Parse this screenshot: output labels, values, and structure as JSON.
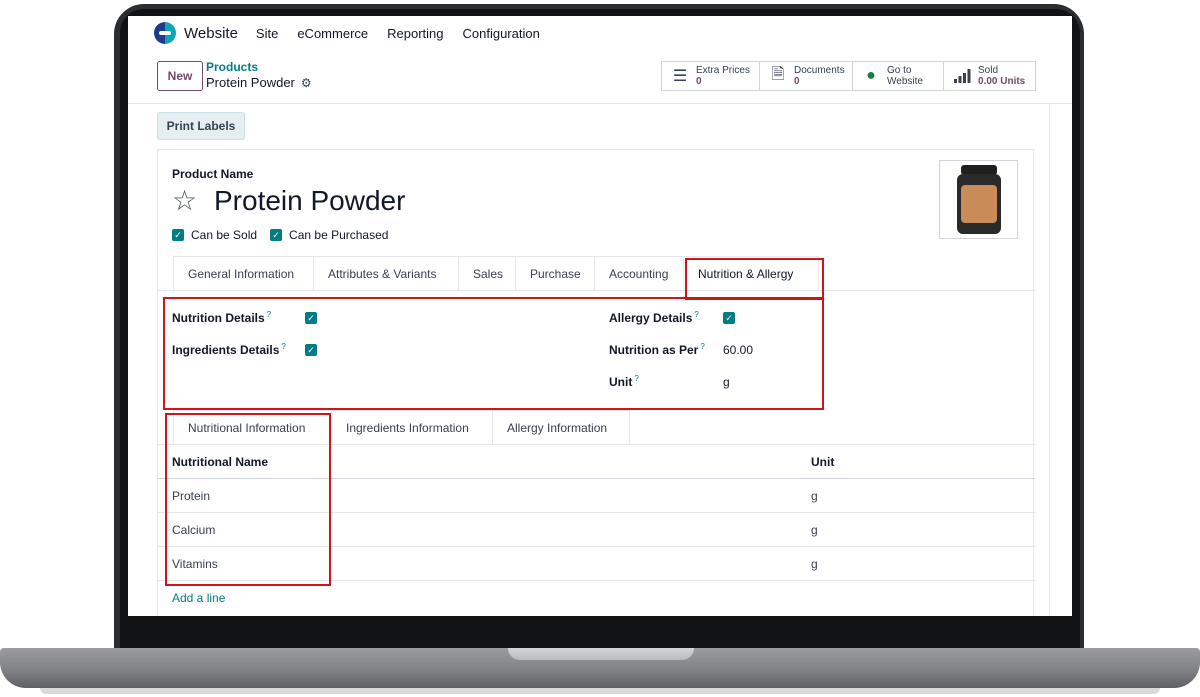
{
  "navbar": {
    "app_name": "Website",
    "menu": [
      "Site",
      "eCommerce",
      "Reporting",
      "Configuration"
    ]
  },
  "control_panel": {
    "new_label": "New",
    "breadcrumb_parent": "Products",
    "breadcrumb_current": "Protein Powder",
    "print_labels": "Print Labels",
    "smart_buttons": [
      {
        "label": "Extra Prices",
        "value": "0",
        "icon": "list-icon"
      },
      {
        "label": "Documents",
        "value": "0",
        "icon": "document-icon"
      },
      {
        "label": "Go to",
        "value": "Website",
        "icon": "globe-icon"
      },
      {
        "label": "Sold",
        "value": "0.00 Units",
        "icon": "bar-chart-icon"
      }
    ]
  },
  "product": {
    "name_label": "Product Name",
    "name": "Protein Powder",
    "can_be_sold": "Can be Sold",
    "can_be_purchased": "Can be Purchased"
  },
  "tabs": [
    "General Information",
    "Attributes & Variants",
    "Sales",
    "Purchase",
    "Accounting",
    "Nutrition & Allergy"
  ],
  "active_tab": "Nutrition & Allergy",
  "nutrition_fields": {
    "nutrition_details": "Nutrition Details",
    "ingredients_details": "Ingredients Details",
    "allergy_details": "Allergy Details",
    "nutrition_as_per": "Nutrition as Per",
    "nutrition_as_per_value": "60.00",
    "unit": "Unit",
    "unit_value": "g",
    "help": "?"
  },
  "subtabs": [
    "Nutritional Information",
    "Ingredients Information",
    "Allergy Information"
  ],
  "table": {
    "headers": [
      "Nutritional Name",
      "Unit"
    ],
    "rows": [
      {
        "name": "Protein",
        "unit": "g"
      },
      {
        "name": "Calcium",
        "unit": "g"
      },
      {
        "name": "Vitamins",
        "unit": "g"
      }
    ],
    "add_line": "Add a line"
  },
  "colors": {
    "accent_teal": "#017e84",
    "brand_purple": "#714b67",
    "highlight_red": "#d0141e"
  }
}
